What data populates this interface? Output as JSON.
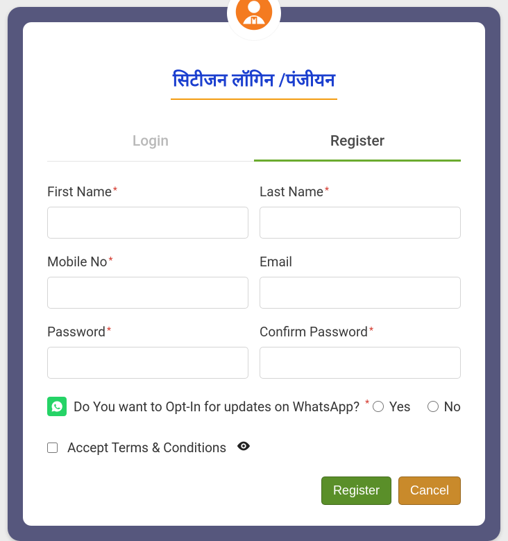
{
  "header": {
    "title": "सिटीजन लॉगिन /पंजीयन"
  },
  "tabs": {
    "login": "Login",
    "register": "Register"
  },
  "form": {
    "first_name": {
      "label": "First Name",
      "value": ""
    },
    "last_name": {
      "label": "Last Name",
      "value": ""
    },
    "mobile": {
      "label": "Mobile No",
      "value": ""
    },
    "email": {
      "label": "Email",
      "value": ""
    },
    "password": {
      "label": "Password",
      "value": ""
    },
    "confirm_password": {
      "label": "Confirm Password",
      "value": ""
    }
  },
  "whatsapp": {
    "question": "Do You want to Opt-In for updates on WhatsApp?",
    "yes": "Yes",
    "no": "No"
  },
  "terms": {
    "label": "Accept Terms & Conditions"
  },
  "buttons": {
    "register": "Register",
    "cancel": "Cancel"
  },
  "required_marker": "*",
  "colors": {
    "frame": "#56577d",
    "accent_orange": "#f39c12",
    "accent_green": "#6bab2f",
    "link_blue": "#1b3fcf",
    "whatsapp": "#25d366",
    "btn_register": "#5a8f29",
    "btn_cancel": "#c98a2b"
  }
}
